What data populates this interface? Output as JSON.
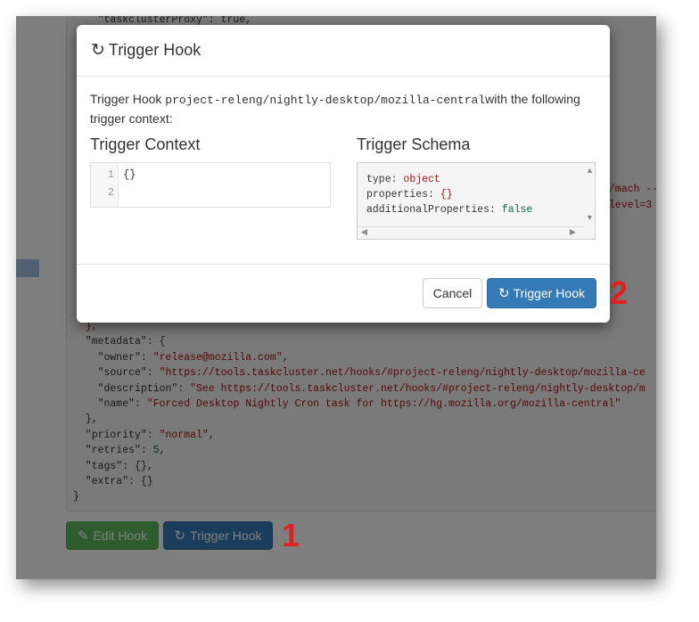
{
  "background_page": {
    "json_lines_top": [
      "    \"taskclusterProxy\": true,"
    ],
    "right_snippets": [
      "./mach --",
      "-level=3"
    ],
    "json_lines": [
      [
        "  ",
        "},",
        ""
      ],
      [
        "  \"metadata\": {",
        "",
        ""
      ],
      [
        "    \"owner\": ",
        "\"release@mozilla.com\"",
        ","
      ],
      [
        "    \"source\": ",
        "\"https://tools.taskcluster.net/hooks/#project-releng/nightly-desktop/mozilla-ce",
        ""
      ],
      [
        "    \"description\": ",
        "\"See https://tools.taskcluster.net/hooks/#project-releng/nightly-desktop/m",
        ""
      ],
      [
        "    \"name\": ",
        "\"Forced Desktop Nightly Cron task for https://hg.mozilla.org/mozilla-central\"",
        ""
      ],
      [
        "  },",
        "",
        ""
      ],
      [
        "  \"priority\": ",
        "\"normal\"",
        ","
      ],
      [
        "  \"retries\": ",
        "5",
        ","
      ],
      [
        "  \"tags\": {},",
        "",
        ""
      ],
      [
        "  \"extra\": {}",
        "",
        ""
      ],
      [
        "}",
        "",
        ""
      ]
    ],
    "edit_hook_label": "Edit Hook",
    "trigger_hook_label": "Trigger Hook"
  },
  "modal": {
    "title": "Trigger Hook",
    "intro_prefix": "Trigger Hook ",
    "hook_id": "project-releng/nightly-desktop/mozilla-central",
    "intro_suffix": "with the following trigger context:",
    "context_heading": "Trigger Context",
    "schema_heading": "Trigger Schema",
    "editor": {
      "line_numbers": [
        "1",
        "2"
      ],
      "content": "{}"
    },
    "schema": {
      "type_key": "type: ",
      "type_val": "object",
      "props_key": "properties: ",
      "props_val": "{}",
      "addl_key": "additionalProperties: ",
      "addl_val": "false"
    },
    "cancel_label": "Cancel",
    "trigger_label": "Trigger Hook"
  },
  "callouts": {
    "first": "1",
    "second": "2"
  },
  "colors": {
    "primary": "#337ab7",
    "success": "#5cb85c",
    "callout_red": "#e02020"
  },
  "icons": {
    "refresh": "refresh-icon",
    "pencil": "pencil-icon"
  }
}
